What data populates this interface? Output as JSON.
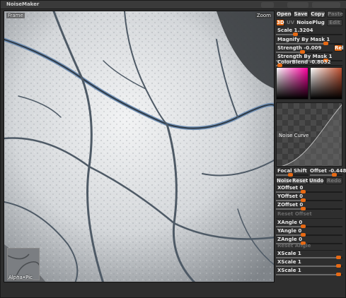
{
  "window": {
    "title": "NoiseMaker"
  },
  "canvas": {
    "frame_label": "Frame",
    "zoom_label": "Zoom",
    "alpha_label": "Alpha•Pic"
  },
  "toolbar": {
    "open": "Open",
    "save": "Save",
    "copy": "Copy",
    "paste": "Paste"
  },
  "mode": {
    "three_d": "3D",
    "uv": "UV",
    "noiseplug": "NoisePlug",
    "edit": "Edit"
  },
  "params": {
    "scale": {
      "label": "Scale",
      "value": "1.3204",
      "fraction": 0.3
    },
    "magnify": {
      "label": "Magnify By Mask",
      "value": "1",
      "fraction": 0.75
    },
    "strength": {
      "label": "Strength",
      "value": "-0.009",
      "fraction": 0.48
    },
    "rel": "Rel",
    "strength_mask": {
      "label": "Strength By Mask",
      "value": "1",
      "fraction": 0.75
    },
    "colorblend": {
      "label": "ColorBlend",
      "value": "-0.8032",
      "fraction": 0.06
    }
  },
  "noise_curve": {
    "label": "Noise Curve"
  },
  "focal": {
    "focal_label": "Focal Shift",
    "offset_label": "Offset",
    "offset_value": "-0.448",
    "focal_fraction": 0.45,
    "offset_fraction": 0.76
  },
  "curve_buttons": {
    "noise": "Noise",
    "reset": "Reset",
    "undo": "Undo",
    "redo": "Redo"
  },
  "offsets": {
    "x": {
      "label": "XOffset",
      "value": "0",
      "fraction": 0.42
    },
    "y": {
      "label": "YOffset",
      "value": "0",
      "fraction": 0.42
    },
    "z": {
      "label": "ZOffset",
      "value": "0",
      "fraction": 0.42
    },
    "reset": "Reset Offset"
  },
  "angles": {
    "x": {
      "label": "XAngle",
      "value": "0",
      "fraction": 0.42
    },
    "y": {
      "label": "YAngle",
      "value": "0",
      "fraction": 0.42
    },
    "z": {
      "label": "ZAngle",
      "value": "0",
      "fraction": 0.42
    },
    "reset": "Reset Angle"
  },
  "scales": {
    "x1": {
      "label": "XScale",
      "value": "1",
      "fraction": 0.95
    },
    "x2": {
      "label": "XScale",
      "value": "1",
      "fraction": 0.95
    },
    "x3": {
      "label": "XScale",
      "value": "1",
      "fraction": 0.95
    }
  },
  "colors": {
    "accent": "#e86a14",
    "panel": "#2e2e2e",
    "crack": "#5d7fa8"
  }
}
